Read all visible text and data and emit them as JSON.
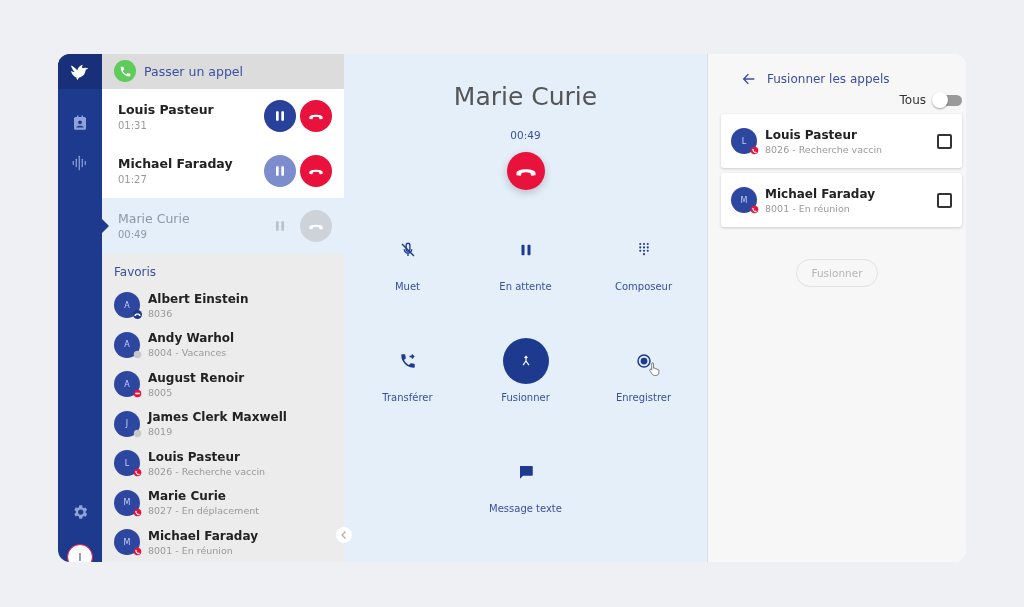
{
  "rail": {
    "avatar_letter": "I"
  },
  "dial": {
    "label": "Passer un appel"
  },
  "calls": [
    {
      "name": "Louis Pasteur",
      "time": "01:31",
      "held": false,
      "selected": false
    },
    {
      "name": "Michael Faraday",
      "time": "01:27",
      "held": true,
      "selected": false
    },
    {
      "name": "Marie Curie",
      "time": "00:49",
      "held": false,
      "selected": true
    }
  ],
  "favorites": {
    "title": "Favoris",
    "items": [
      {
        "initial": "A",
        "name": "Albert Einstein",
        "detail": "8036",
        "presence": {
          "kind": "ringing"
        }
      },
      {
        "initial": "A",
        "name": "Andy Warhol",
        "detail": "8004 - Vacances",
        "presence": {
          "kind": "away"
        }
      },
      {
        "initial": "A",
        "name": "August Renoir",
        "detail": "8005",
        "presence": {
          "kind": "dnd"
        }
      },
      {
        "initial": "J",
        "name": "James Clerk Maxwell",
        "detail": "8019",
        "presence": {
          "kind": "away"
        }
      },
      {
        "initial": "L",
        "name": "Louis Pasteur",
        "detail": "8026 - Recherche vaccin",
        "presence": {
          "kind": "in_call"
        }
      },
      {
        "initial": "M",
        "name": "Marie Curie",
        "detail": "8027 - En déplacement",
        "presence": {
          "kind": "in_call"
        }
      },
      {
        "initial": "M",
        "name": "Michael Faraday",
        "detail": "8001 - En réunion",
        "presence": {
          "kind": "in_call"
        }
      }
    ]
  },
  "active_call": {
    "name": "Marie Curie",
    "time": "00:49"
  },
  "actions": [
    {
      "kind": "mute",
      "label": "Muet",
      "active": false
    },
    {
      "kind": "hold",
      "label": "En attente",
      "active": false
    },
    {
      "kind": "dialpad",
      "label": "Composeur",
      "active": false
    },
    {
      "kind": "transfer",
      "label": "Transférer",
      "active": false
    },
    {
      "kind": "merge",
      "label": "Fusionner",
      "active": true
    },
    {
      "kind": "record",
      "label": "Enregistrer",
      "active": false
    },
    {
      "kind": "message",
      "label": "Message texte",
      "active": false
    }
  ],
  "merge_panel": {
    "title": "Fusionner les appels",
    "all_label": "Tous",
    "all_on": false,
    "items": [
      {
        "initial": "L",
        "name": "Louis Pasteur",
        "detail": "8026 - Recherche vaccin",
        "presence": {
          "kind": "in_call"
        },
        "checked": false
      },
      {
        "initial": "M",
        "name": "Michael Faraday",
        "detail": "8001 - En réunion",
        "presence": {
          "kind": "in_call"
        },
        "checked": false
      }
    ],
    "button": {
      "label": "Fusionner",
      "disabled": true
    }
  }
}
